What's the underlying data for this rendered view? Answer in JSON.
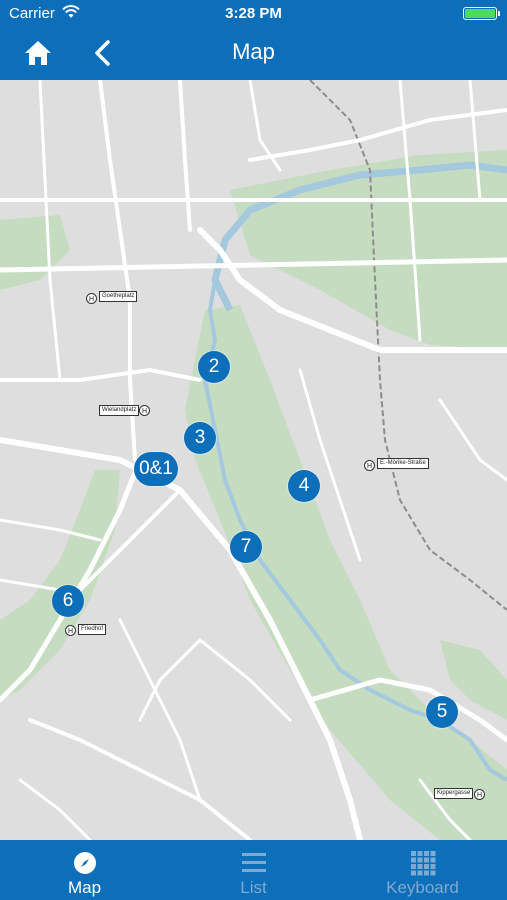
{
  "status_bar": {
    "carrier": "Carrier",
    "time": "3:28 PM"
  },
  "nav": {
    "title": "Map",
    "home_icon": "home-icon",
    "back_icon": "chevron-left-icon"
  },
  "markers": [
    {
      "id": "2",
      "label": "2"
    },
    {
      "id": "3",
      "label": "3"
    },
    {
      "id": "0and1",
      "label": "0&1"
    },
    {
      "id": "4",
      "label": "4"
    },
    {
      "id": "7",
      "label": "7"
    },
    {
      "id": "6",
      "label": "6"
    },
    {
      "id": "5",
      "label": "5"
    }
  ],
  "stops": [
    {
      "name": "Goetheplatz"
    },
    {
      "name": "Wielandplatz"
    },
    {
      "name": "E.-Mörike-Straße"
    },
    {
      "name": "Friedhof"
    },
    {
      "name": "Kippergasse"
    }
  ],
  "tabs": [
    {
      "label": "Map",
      "icon": "compass-icon",
      "active": true
    },
    {
      "label": "List",
      "icon": "list-icon",
      "active": false
    },
    {
      "label": "Keyboard",
      "icon": "keypad-icon",
      "active": false
    }
  ],
  "colors": {
    "brand": "#0d6fba",
    "park": "#c5dcc0",
    "river": "#a4c8de",
    "road": "#ffffff",
    "background": "#dedede"
  }
}
